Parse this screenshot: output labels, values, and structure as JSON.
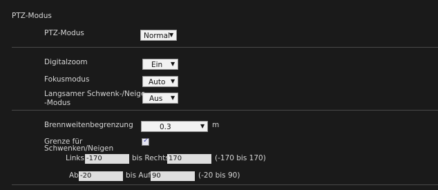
{
  "section": {
    "title": "PTZ-Modus"
  },
  "ptz_mode": {
    "label": "PTZ-Modus",
    "value": "Normal"
  },
  "digital_zoom": {
    "label": "Digitalzoom",
    "value": "Ein"
  },
  "focus_mode": {
    "label": "Fokusmodus",
    "value": "Auto"
  },
  "slow_pan_tilt": {
    "label_line1": "Langsamer Schwenk-/Neige",
    "label_line2": "-Modus",
    "value": "Aus"
  },
  "focal_limit": {
    "label": "Brennweitenbegrenzung",
    "value": "0.3",
    "unit": "m"
  },
  "pan_tilt_limit": {
    "label_line1": "Grenze für",
    "label_line2": "Schwenken/Neigen",
    "checked": true
  },
  "pan": {
    "left_label": "Links",
    "left_value": "-170",
    "right_label": "bis Rechts",
    "right_value": "170",
    "range": "(-170 bis 170)"
  },
  "tilt": {
    "down_label": "Ab",
    "down_value": "-20",
    "up_label": "bis Auf",
    "up_value": "90",
    "range": "(-20 bis 90)"
  },
  "icons": {
    "dropdown": "dropdown-arrow-icon",
    "check": "checkmark-icon"
  }
}
